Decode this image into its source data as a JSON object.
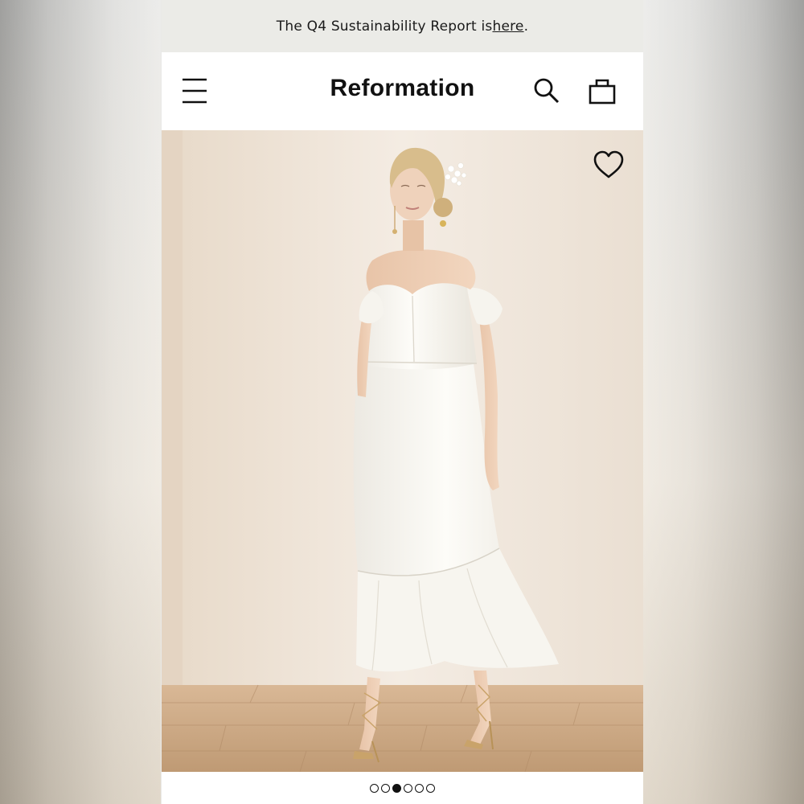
{
  "announcement": {
    "text": "The Q4 Sustainability Report is ",
    "link_text": "here",
    "suffix": "."
  },
  "header": {
    "brand": "Reformation",
    "icons": [
      "menu-icon",
      "search-icon",
      "bag-icon"
    ]
  },
  "product_image": {
    "favorite_icon": "heart-icon",
    "favorited": false
  },
  "carousel": {
    "total": 6,
    "active_index": 2
  },
  "colors": {
    "announcement_bg": "#ebebe7",
    "text": "#111111",
    "wall": "#f1e7dc",
    "floor": "#caa27c",
    "dress": "#fbfaf6"
  }
}
